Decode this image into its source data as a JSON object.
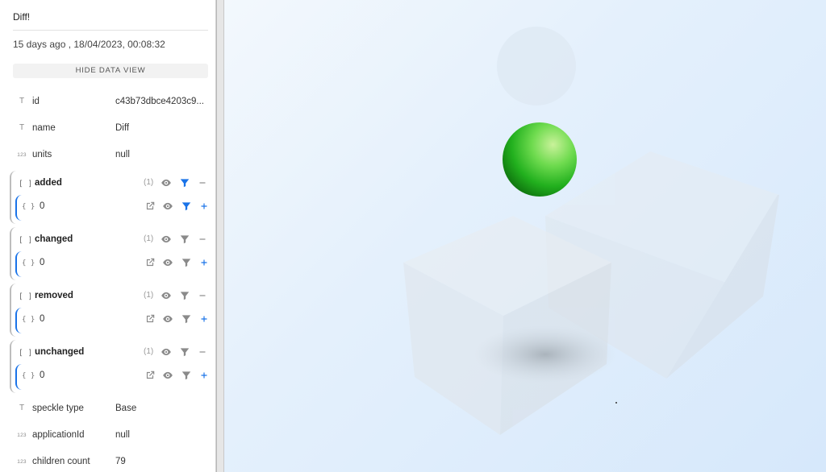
{
  "object": {
    "title": "Diff!",
    "date": "15 days ago , 18/04/2023, 00:08:32",
    "hide_button_label": "HIDE DATA VIEW"
  },
  "properties_top": [
    {
      "type_icon": "T",
      "key": "id",
      "value": "c43b73dbce4203c9..."
    },
    {
      "type_icon": "T",
      "key": "name",
      "value": "Diff"
    },
    {
      "type_icon": "123",
      "key": "units",
      "value": "null"
    }
  ],
  "groups": [
    {
      "key": "added",
      "count": "(1)",
      "filter_active": true,
      "child": {
        "key": "0"
      }
    },
    {
      "key": "changed",
      "count": "(1)",
      "filter_active": false,
      "child": {
        "key": "0"
      }
    },
    {
      "key": "removed",
      "count": "(1)",
      "filter_active": false,
      "child": {
        "key": "0"
      }
    },
    {
      "key": "unchanged",
      "count": "(1)",
      "filter_active": false,
      "child": {
        "key": "0"
      }
    }
  ],
  "group_icon": "[ ]",
  "child_icon": "{ }",
  "properties_bottom": [
    {
      "type_icon": "T",
      "key": "speckle type",
      "value": "Base"
    },
    {
      "type_icon": "123",
      "key": "applicationId",
      "value": "null"
    },
    {
      "type_icon": "123",
      "key": "children count",
      "value": "79"
    }
  ],
  "colors": {
    "accent": "#1a73e8",
    "icon_gray": "#8a8a8a",
    "sphere_green": "#3cc83c"
  }
}
